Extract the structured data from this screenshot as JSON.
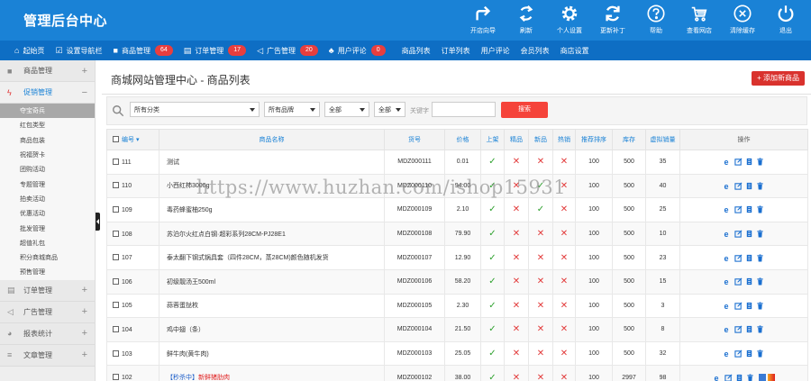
{
  "header": {
    "title": "管理后台中心",
    "tools": [
      {
        "label": "开店向导",
        "icon": "share-arrow-icon"
      },
      {
        "label": "刷新",
        "icon": "refresh-arrows-icon"
      },
      {
        "label": "个人设置",
        "icon": "gear-icon"
      },
      {
        "label": "更新补丁",
        "icon": "sync-icon"
      },
      {
        "label": "帮助",
        "icon": "help-icon"
      },
      {
        "label": "查看网店",
        "icon": "cart-icon"
      },
      {
        "label": "清除缓存",
        "icon": "close-circle-icon"
      },
      {
        "label": "退出",
        "icon": "power-icon"
      }
    ]
  },
  "navbar": {
    "items": [
      {
        "label": "起始页",
        "icon": "home-icon"
      },
      {
        "label": "设置导航栏",
        "icon": "checkbox-icon"
      },
      {
        "label": "商品管理",
        "icon": "folder-icon",
        "badge": "64"
      },
      {
        "label": "订单管理",
        "icon": "document-icon",
        "badge": "17"
      },
      {
        "label": "广告管理",
        "icon": "megaphone-icon",
        "badge": "20"
      },
      {
        "label": "用户评论",
        "icon": "users-icon",
        "badge": "0"
      },
      {
        "label": "商品列表"
      },
      {
        "label": "订单列表"
      },
      {
        "label": "用户评论"
      },
      {
        "label": "会员列表"
      },
      {
        "label": "商店设置"
      }
    ]
  },
  "sidebar": {
    "groups": [
      {
        "label": "商品管理",
        "icon": "folder-icon",
        "toggle": "+"
      },
      {
        "label": "促销管理",
        "icon": "bolt-icon",
        "toggle": "−"
      }
    ],
    "promo_items": [
      "夺宝奇兵",
      "红包类型",
      "商品包装",
      "祝福贺卡",
      "团购活动",
      "专题管理",
      "拍卖活动",
      "优惠活动",
      "批发管理",
      "超值礼包",
      "积分商城商品",
      "预售管理"
    ],
    "groups_after": [
      {
        "label": "订单管理",
        "icon": "clipboard-icon",
        "toggle": "+"
      },
      {
        "label": "广告管理",
        "icon": "megaphone-icon",
        "toggle": "+"
      },
      {
        "label": "报表统计",
        "icon": "pie-chart-icon",
        "toggle": "+"
      },
      {
        "label": "文章管理",
        "icon": "list-icon",
        "toggle": "+"
      }
    ]
  },
  "page": {
    "title": "商城网站管理中心 - 商品列表",
    "add_button": "+ 添加新商品"
  },
  "filter": {
    "category": "所有分类",
    "brand": "所有品牌",
    "select3": "全部",
    "select4": "全部",
    "keyword_label": "关键字",
    "keyword_value": "",
    "search_button": "搜索"
  },
  "table": {
    "headers": [
      "编号",
      "商品名称",
      "货号",
      "价格",
      "上架",
      "精品",
      "新品",
      "热销",
      "推荐排序",
      "库存",
      "虚拟销量",
      "操作"
    ],
    "rows": [
      {
        "id": "111",
        "name": "测试",
        "sn": "MDZ000111",
        "price": "0.01",
        "onsale": true,
        "best": false,
        "new": false,
        "hot": false,
        "sort": "100",
        "stock": "500",
        "vsales": "35"
      },
      {
        "id": "110",
        "name": "小西红柿3000g",
        "sn": "MDZ000110",
        "price": "94.00",
        "onsale": true,
        "best": false,
        "new": true,
        "hot": false,
        "sort": "100",
        "stock": "500",
        "vsales": "40"
      },
      {
        "id": "109",
        "name": "毒药蜂蜜柚250g",
        "sn": "MDZ000109",
        "price": "2.10",
        "onsale": true,
        "best": false,
        "new": true,
        "hot": false,
        "sort": "100",
        "stock": "500",
        "vsales": "25"
      },
      {
        "id": "108",
        "name": "苏泊尔火红点白钢·超彩系列28CM-PJ28E1",
        "sn": "MDZ000108",
        "price": "79.90",
        "onsale": true,
        "best": false,
        "new": false,
        "hot": false,
        "sort": "100",
        "stock": "500",
        "vsales": "10"
      },
      {
        "id": "107",
        "name": "泰太翻下钢式锅具套（四件28CM，蒸28CM)颜色随机发货",
        "sn": "MDZ000107",
        "price": "12.90",
        "onsale": true,
        "best": false,
        "new": false,
        "hot": false,
        "sort": "100",
        "stock": "500",
        "vsales": "23"
      },
      {
        "id": "106",
        "name": "初级靓汤王500ml",
        "sn": "MDZ000106",
        "price": "58.20",
        "onsale": true,
        "best": false,
        "new": false,
        "hot": false,
        "sort": "100",
        "stock": "500",
        "vsales": "15"
      },
      {
        "id": "105",
        "name": "蒜蓉蛋挞枚",
        "sn": "MDZ000105",
        "price": "2.30",
        "onsale": true,
        "best": false,
        "new": false,
        "hot": false,
        "sort": "100",
        "stock": "500",
        "vsales": "3"
      },
      {
        "id": "104",
        "name": "鸡中翅（条）",
        "sn": "MDZ000104",
        "price": "21.50",
        "onsale": true,
        "best": false,
        "new": false,
        "hot": false,
        "sort": "100",
        "stock": "500",
        "vsales": "8"
      },
      {
        "id": "103",
        "name": "鲜牛肉(黄牛肉)",
        "sn": "MDZ000103",
        "price": "25.05",
        "onsale": true,
        "best": false,
        "new": false,
        "hot": false,
        "sort": "100",
        "stock": "500",
        "vsales": "32"
      },
      {
        "id": "102",
        "tag": "【秒杀中】",
        "name": "新鲜猪肋肉",
        "sn": "MDZ000102",
        "price": "38.00",
        "onsale": true,
        "best": false,
        "new": false,
        "hot": false,
        "sort": "100",
        "stock": "2997",
        "vsales": "98",
        "extra": true
      }
    ]
  },
  "watermark": "https://www.huzhan.com/ishop15931",
  "colors": {
    "header": "#1a82d6",
    "navbar": "#0e6ec4",
    "accent_red": "#d9322d",
    "check_green": "#2fa12f",
    "cross_red": "#e23a3a"
  }
}
